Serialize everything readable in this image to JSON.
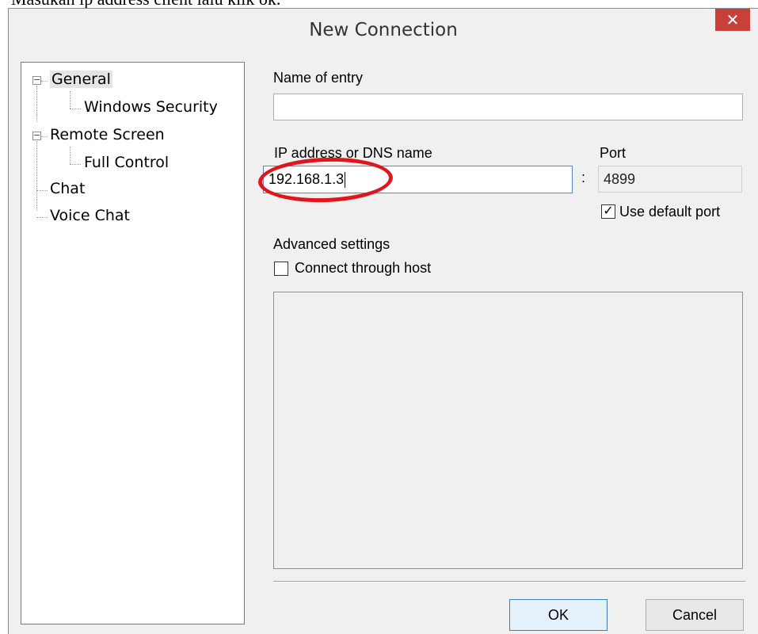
{
  "caption": "Masukan ip address client lalu klik ok.",
  "window": {
    "title": "New Connection",
    "close_glyph": "✕"
  },
  "tree": {
    "items": [
      {
        "label": "General",
        "expander": "−",
        "selected": true
      },
      {
        "label": "Windows Security"
      },
      {
        "label": "Remote Screen",
        "expander": "−"
      },
      {
        "label": "Full Control"
      },
      {
        "label": "Chat"
      },
      {
        "label": "Voice Chat"
      }
    ]
  },
  "form": {
    "name_label": "Name of entry",
    "name_value": "",
    "ip_label": "IP address or DNS name",
    "ip_value": "192.168.1.3",
    "port_label": "Port",
    "port_separator": ":",
    "port_value": "4899",
    "use_default_port_label": "Use default port",
    "use_default_port_checked": true,
    "advanced_label": "Advanced settings",
    "connect_through_host_label": "Connect through host",
    "connect_through_host_checked": false,
    "check_glyph": "✓"
  },
  "buttons": {
    "ok": "OK",
    "cancel": "Cancel"
  },
  "colors": {
    "annotation": "#e0161c",
    "close_button": "#c7403a",
    "focus_border": "#4a8bd6"
  }
}
